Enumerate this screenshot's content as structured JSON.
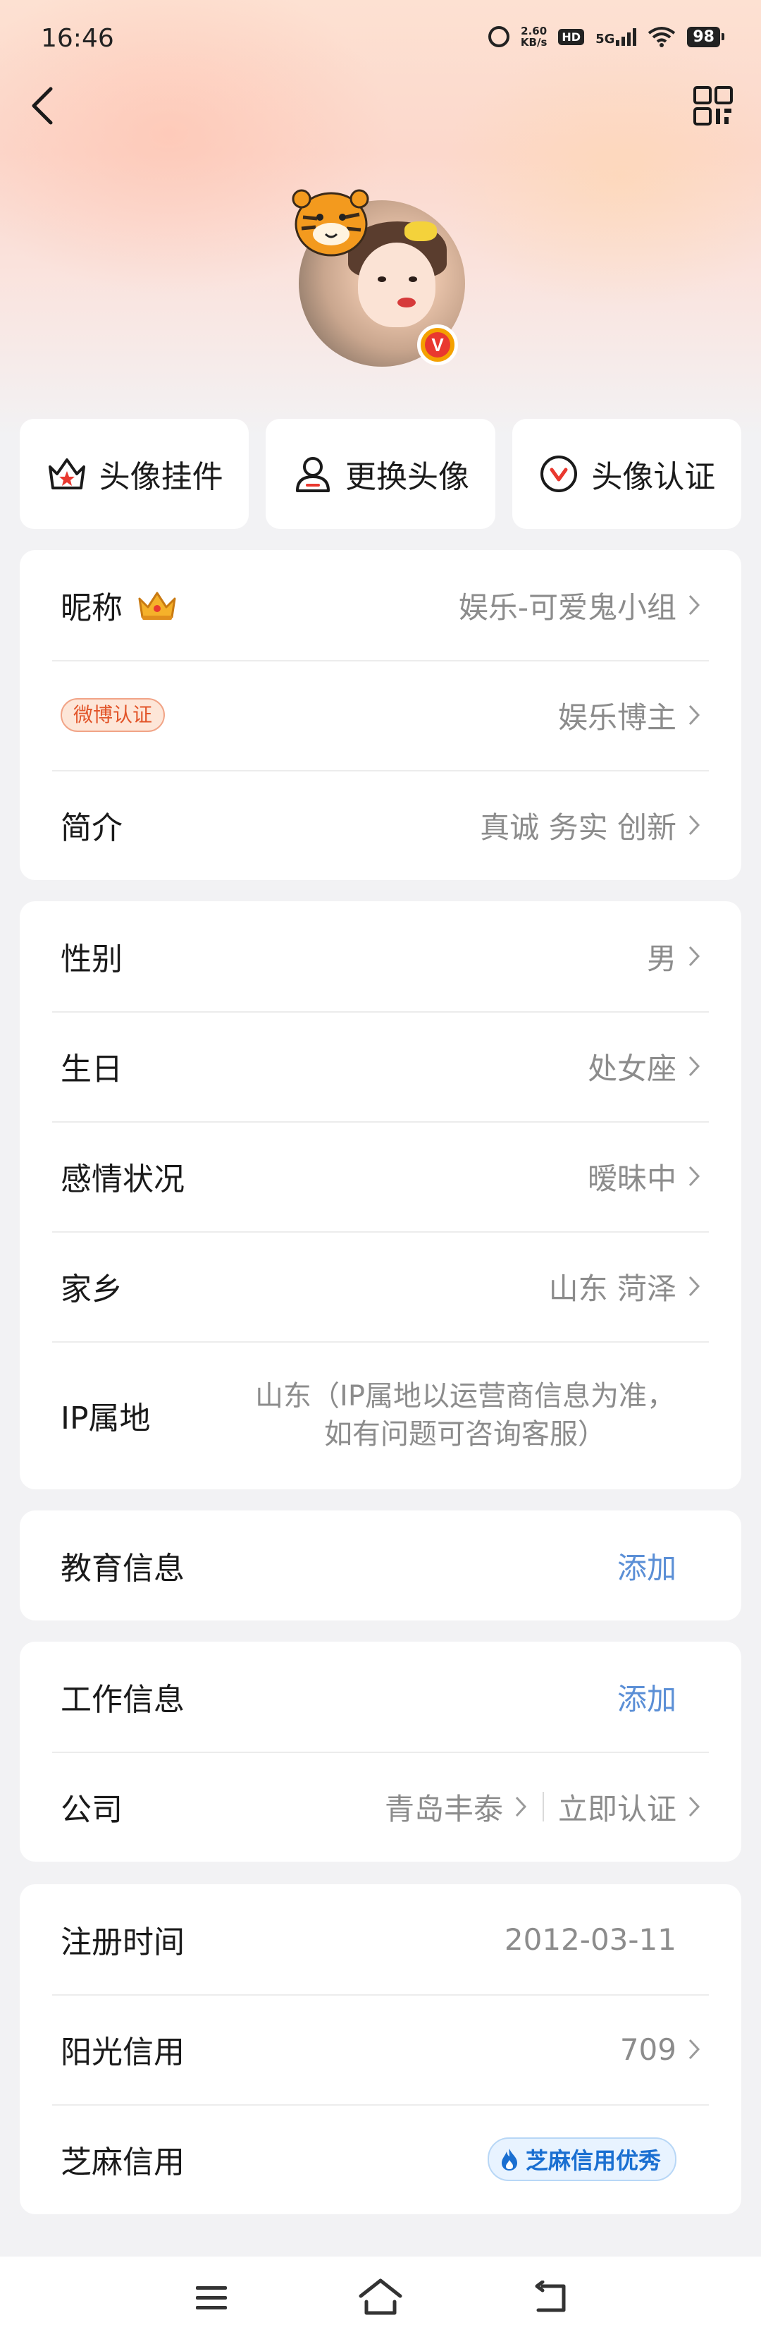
{
  "status_bar": {
    "time": "16:46",
    "net_speed_value": "2.60",
    "net_speed_unit": "KB/s",
    "hd_label": "HD",
    "network_label": "5G",
    "battery": "98"
  },
  "actions": [
    {
      "label": "头像挂件",
      "icon": "pendant-icon"
    },
    {
      "label": "更换头像",
      "icon": "user-icon"
    },
    {
      "label": "头像认证",
      "icon": "verify-icon"
    }
  ],
  "profile": {
    "nickname_label": "昵称",
    "nickname_value": "娱乐-可爱鬼小组",
    "weibo_tag": "微博认证",
    "weibo_value": "娱乐博主",
    "intro_label": "简介",
    "intro_value": "真诚 务实 创新"
  },
  "personal": {
    "gender_label": "性别",
    "gender_value": "男",
    "birthday_label": "生日",
    "birthday_value": "处女座",
    "relationship_label": "感情状况",
    "relationship_value": "暧昧中",
    "hometown_label": "家乡",
    "hometown_value": "山东 菏泽",
    "ip_label": "IP属地",
    "ip_value": "山东（IP属地以运营商信息为准，如有问题可咨询客服）"
  },
  "education": {
    "label": "教育信息",
    "action": "添加"
  },
  "work": {
    "label": "工作信息",
    "action": "添加",
    "company_label": "公司",
    "company_value": "青岛丰泰",
    "company_verify": "立即认证"
  },
  "account": {
    "register_label": "注册时间",
    "register_value": "2012-03-11",
    "sunshine_label": "阳光信用",
    "sunshine_value": "709",
    "zhima_label": "芝麻信用",
    "zhima_badge": "芝麻信用优秀"
  },
  "avatar_badge": "V",
  "colors": {
    "link": "#5b8fd6",
    "badge_orange": "#f4a100",
    "badge_red": "#e9382f",
    "weibo_tag": "#e2552a",
    "zhima_blue": "#1a6fd1"
  }
}
